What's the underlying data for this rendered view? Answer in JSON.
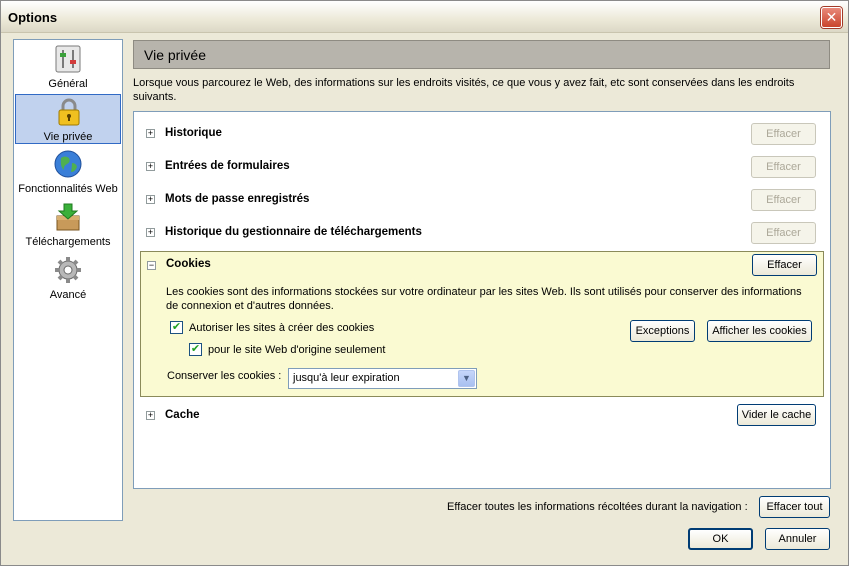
{
  "window": {
    "title": "Options",
    "close_glyph": "✕"
  },
  "sidebar": {
    "items": [
      {
        "label": "Général",
        "icon": "general-icon"
      },
      {
        "label": "Vie privée",
        "icon": "lock-icon",
        "selected": true
      },
      {
        "label": "Fonctionnalités Web",
        "icon": "globe-icon"
      },
      {
        "label": "Téléchargements",
        "icon": "download-icon"
      },
      {
        "label": "Avancé",
        "icon": "gear-icon"
      }
    ]
  },
  "main": {
    "header": "Vie privée",
    "intro": "Lorsque vous parcourez le Web, des informations sur les endroits visités, ce que vous y avez fait, etc sont conservées dans les endroits suivants.",
    "rows": [
      {
        "title": "Historique",
        "toggle": "+",
        "button": "Effacer"
      },
      {
        "title": "Entrées de formulaires",
        "toggle": "+",
        "button": "Effacer"
      },
      {
        "title": "Mots de passe enregistrés",
        "toggle": "+",
        "button": "Effacer"
      },
      {
        "title": "Historique du gestionnaire de téléchargements",
        "toggle": "+",
        "button": "Effacer"
      }
    ],
    "cookies": {
      "title": "Cookies",
      "toggle": "−",
      "button": "Effacer",
      "description": "Les cookies sont des informations stockées sur votre ordinateur par les sites Web. Ils sont utilisés pour conserver des informations de connexion et d'autres données.",
      "allow_label": "Autoriser les sites à créer des cookies",
      "allow_checked": "✔",
      "origin_label": "pour le site Web d'origine seulement",
      "origin_checked": "✔",
      "exceptions_button": "Exceptions",
      "show_button": "Afficher les cookies",
      "keep_label": "Conserver les cookies :",
      "keep_value": "jusqu'à leur expiration",
      "dropdown_arrow": "▼"
    },
    "cache": {
      "title": "Cache",
      "toggle": "+",
      "button": "Vider le cache"
    }
  },
  "footer": {
    "label": "Effacer toutes les informations récoltées durant la navigation :",
    "clear_all_button": "Effacer tout",
    "ok_button": "OK",
    "cancel_button": "Annuler"
  }
}
